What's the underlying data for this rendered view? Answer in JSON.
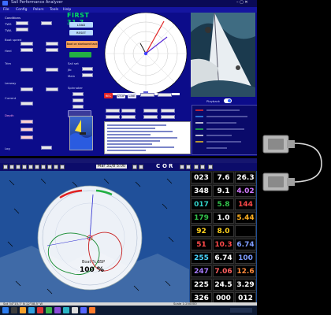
{
  "colors": {
    "first_green": "#00e060",
    "panel_blue": "#0c0c8a",
    "chart_blue": "#1f4f98"
  },
  "top_window": {
    "title": "Sail Performance Analyzer",
    "first": "FIRST 31.7",
    "load_label": "LOAD",
    "reset_label": "RESET",
    "boat_state_label": "Boat on starboard tack",
    "menu": [
      "File",
      "Config",
      "Polars",
      "Tools",
      "Help"
    ],
    "left_labels": [
      "Conditions",
      "TWS",
      "TWA",
      "Boat speed",
      "Heel",
      "Trim",
      "Leeway",
      "Current",
      "Depth",
      "Log",
      "Waves"
    ],
    "mid_labels": [
      "Sail set",
      "Jib",
      "Main",
      "Spinnaker",
      "Gennaker",
      "Reef"
    ],
    "lower_labels": [
      "Targets",
      "Polar %",
      "Offset",
      "VMG",
      "Laylines"
    ],
    "plot_buttons": [
      "REC",
      "STOP",
      "LIVE"
    ],
    "toggle_label": "Playback"
  },
  "bottom_window": {
    "toolbar_label": "Mar 31/8  5:00",
    "toolbar_letters": [
      "C",
      "O",
      "R"
    ],
    "polar_text": "Boat % BSP",
    "polar_value": "100 %",
    "status_left": "Sat  34°15.7' N  12°08.5' W",
    "status_right": "Scale 1:250000"
  },
  "instruments": [
    [
      "023",
      "7.6",
      "26.3"
    ],
    [
      "348",
      "9.1",
      "4.02"
    ],
    [
      "017",
      "5.8",
      "144"
    ],
    [
      "179",
      "1.0",
      "5.44"
    ],
    [
      "92",
      "8.0",
      ""
    ],
    [
      "51",
      "10.3",
      "6.74"
    ],
    [
      "255",
      "6.74",
      "100"
    ],
    [
      "247",
      "7.06",
      "12.6"
    ],
    [
      "225",
      "24.5",
      "3.29"
    ],
    [
      "326",
      "000",
      "012"
    ]
  ],
  "instrument_colors": [
    [
      "#ffffff",
      "#ffffff",
      "#ffffff"
    ],
    [
      "#ffffff",
      "#ffffff",
      "#d27bff"
    ],
    [
      "#32d2c8",
      "#32c24b",
      "#ff4a4a"
    ],
    [
      "#32c24b",
      "#ffffff",
      "#ffb020"
    ],
    [
      "#ffd21e",
      "#ffd21e",
      "#ffffff"
    ],
    [
      "#ff4a4a",
      "#ff4a4a",
      "#7f9dff"
    ],
    [
      "#4ad7ff",
      "#ffffff",
      "#7f9dff"
    ],
    [
      "#a77bff",
      "#ff6060",
      "#ff8a3b"
    ],
    [
      "#ffffff",
      "#ffffff",
      "#ffffff"
    ],
    [
      "#ffffff",
      "#ffffff",
      "#ffffff"
    ]
  ]
}
